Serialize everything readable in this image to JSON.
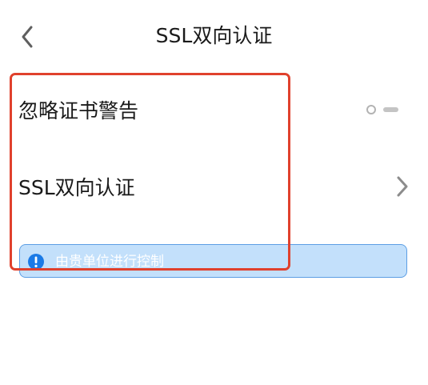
{
  "header": {
    "title": "SSL双向认证"
  },
  "settings": {
    "ignore_cert_warning": {
      "label": "忽略证书警告",
      "toggle_state": "off"
    },
    "ssl_mutual_auth": {
      "label": "SSL双向认证"
    }
  },
  "notice": {
    "text": "由贵单位进行控制",
    "icon": "info-icon"
  },
  "icons": {
    "back": "chevron-left-icon",
    "row_arrow": "chevron-right-icon"
  },
  "colors": {
    "notice_background": "#c3e0fb",
    "notice_border": "#5c9ee4",
    "notice_icon": "#1b7ae6",
    "highlight_border": "#e0412d",
    "toggle_off": "#c4c4c4"
  }
}
